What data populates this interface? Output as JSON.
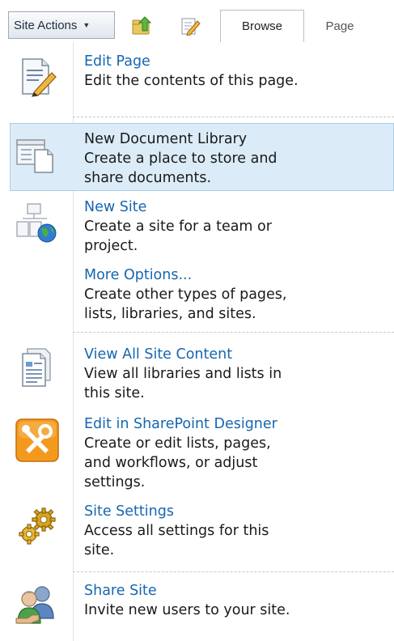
{
  "ribbon": {
    "site_actions_label": "Site Actions",
    "tabs": [
      {
        "label": "Browse",
        "selected": true
      },
      {
        "label": "Page",
        "selected": false
      }
    ]
  },
  "menu": {
    "items": [
      {
        "title": "Edit Page",
        "description": "Edit the contents of this page.",
        "icon": "edit-page-icon"
      },
      {
        "title": "New Document Library",
        "description": "Create a place to store and\nshare documents.",
        "icon": "document-library-icon",
        "highlighted": true
      },
      {
        "title": "New Site",
        "description": "Create a site for a team or\nproject.",
        "icon": "new-site-icon"
      },
      {
        "title": "More Options...",
        "description": "Create other types of pages,\nlists, libraries, and sites."
      },
      {
        "title": "View All Site Content",
        "description": "View all libraries and lists in\nthis site.",
        "icon": "site-content-icon"
      },
      {
        "title": "Edit in SharePoint Designer",
        "description": "Create or edit lists, pages,\nand workflows, or adjust\nsettings.",
        "icon": "sharepoint-designer-icon"
      },
      {
        "title": "Site Settings",
        "description": "Access all settings for this\nsite.",
        "icon": "gears-icon"
      },
      {
        "title": "Share Site",
        "description": "Invite new users to your site.",
        "icon": "share-people-icon"
      }
    ]
  },
  "colors": {
    "link": "#1666b0",
    "highlight_bg": "#dbecf8",
    "highlight_border": "#a9cde8",
    "designer_orange": "#f39a1e"
  }
}
